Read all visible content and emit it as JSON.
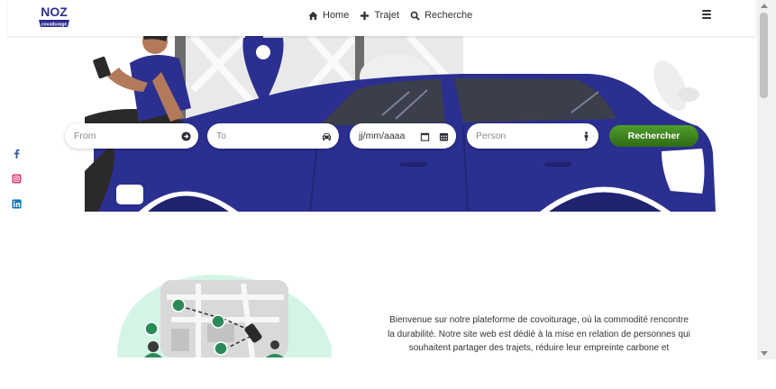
{
  "header": {
    "logo_text": "NOZ",
    "logo_sub": "covoiturage",
    "nav": [
      {
        "label": "Home",
        "icon": "home-icon"
      },
      {
        "label": "Trajet",
        "icon": "plus-icon"
      },
      {
        "label": "Recherche",
        "icon": "search-icon"
      }
    ],
    "menu_icon": "hamburger-icon"
  },
  "search": {
    "from_placeholder": "From",
    "to_placeholder": "To",
    "date_placeholder": "jj/mm/aaaa",
    "person_placeholder": "Person",
    "button_label": "Rechercher"
  },
  "socials": [
    "facebook-icon",
    "instagram-icon",
    "linkedin-icon"
  ],
  "colors": {
    "brand_blue": "#2b2f8f",
    "button_green": "#3f8a1f",
    "mint": "#d4f5e6"
  },
  "intro": {
    "text": "Bienvenue sur notre plateforme de covoiturage, où la commodité rencontre la durabilité. Notre site web est dédié à la mise en relation de personnes qui souhaitent partager des trajets, réduire leur empreinte carbone et"
  }
}
